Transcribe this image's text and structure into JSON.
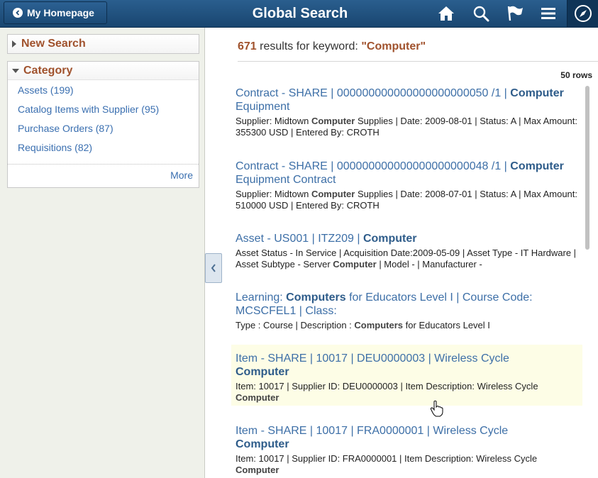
{
  "header": {
    "home_label": "My Homepage",
    "title": "Global Search",
    "icons": [
      "home-icon",
      "search-icon",
      "flag-icon",
      "menu-icon",
      "compass-icon"
    ],
    "bg_color": "#1c4d7a"
  },
  "left": {
    "new_search_label": "New Search",
    "category_label": "Category",
    "categories": [
      {
        "label": "Assets (199)"
      },
      {
        "label": "Catalog Items with Supplier (95)"
      },
      {
        "label": "Purchase Orders (87)"
      },
      {
        "label": "Requisitions (82)"
      }
    ],
    "more_label": "More"
  },
  "results": {
    "count": "671",
    "for_text": "results for keyword:",
    "keyword": "\"Computer\"",
    "rows_label": "50 rows",
    "items": [
      {
        "title_a": "Contract - SHARE | 000000000000000000000050 /1 |",
        "title_b": "Computer",
        "title_c": "Equipment",
        "desc_a": "Supplier: Midtown",
        "desc_b": "Computer",
        "desc_c": "Supplies | Date: 2009-08-01 | Status: A | Max Amount: 355300 USD | Entered By: CROTH"
      },
      {
        "title_a": "Contract - SHARE | 000000000000000000000048 /1 |",
        "title_b": "Computer",
        "title_c": "Equipment Contract",
        "desc_a": "Supplier: Midtown",
        "desc_b": "Computer",
        "desc_c": "Supplies | Date: 2008-07-01 | Status: A | Max Amount: 510000 USD | Entered By: CROTH"
      },
      {
        "title_a": "Asset - US001 | ITZ209 |",
        "title_b": "Computer",
        "title_c": "",
        "desc_a": "Asset Status - In Service | Acquisition Date:2009-05-09 | Asset Type - IT Hardware | Asset Subtype - Server",
        "desc_b": "Computer",
        "desc_c": "| Model - | Manufacturer -"
      },
      {
        "title_a": "Learning:",
        "title_b": "Computers",
        "title_c": "for Educators Level I | Course Code: MCSCFEL1 | Class:",
        "desc_a": "Type : Course | Description :",
        "desc_b": "Computers",
        "desc_c": "for Educators Level I"
      },
      {
        "title_a": "Item - SHARE | 10017 | DEU0000003 | Wireless Cycle",
        "title_b": "Computer",
        "title_c": "",
        "desc_a": "Item: 10017 | Supplier ID: DEU0000003 | Item Description: Wireless Cycle",
        "desc_b": "Computer",
        "desc_c": ""
      },
      {
        "title_a": "Item - SHARE | 10017 | FRA0000001 | Wireless Cycle",
        "title_b": "Computer",
        "title_c": "",
        "desc_a": "Item: 10017 | Supplier ID: FRA0000001 | Item Description: Wireless Cycle",
        "desc_b": "Computer",
        "desc_c": ""
      }
    ]
  }
}
